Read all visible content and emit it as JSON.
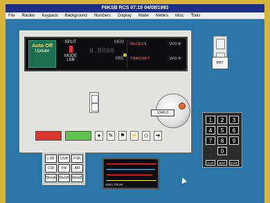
{
  "window": {
    "title": "F6KSB RCS 07:15 04/08/1993"
  },
  "menu": {
    "items": [
      "File",
      "Radios",
      "Keypads",
      "Background",
      "Numbers",
      "Display",
      "Mode",
      "Meters",
      "Misc",
      "Tools"
    ]
  },
  "display": {
    "auto_label": "Auto Off",
    "auto_sub": "Update",
    "split_label": "SPLIT",
    "mode_label": "MODE",
    "mode_value": "LSB",
    "mem_label": "MEM",
    "pre_label": "PRE",
    "freq": "0.0000",
    "receive_label": "RECEIVE",
    "transmit_label": "TRANSMIT",
    "vfo_rx": "VFO B",
    "vfo_tx": "VFO B"
  },
  "buttons": {
    "red_label": "",
    "green_label": ""
  },
  "knob": {
    "value_label": "1340.0"
  },
  "side": {
    "tag_label": "PBT"
  },
  "keypad": {
    "keys": [
      "1",
      "2",
      "3",
      "4",
      "5",
      "6",
      "7",
      "8",
      "9",
      "0"
    ],
    "bottom": [
      "CLR",
      "ENT",
      "EXIT"
    ]
  },
  "modes": {
    "keys": [
      "LSB",
      "USB",
      "FSK",
      "CW",
      "FM",
      "AM",
      "WebA",
      "WebB",
      "WebB"
    ]
  },
  "spectrum": {
    "label": "SPECTRUM"
  }
}
